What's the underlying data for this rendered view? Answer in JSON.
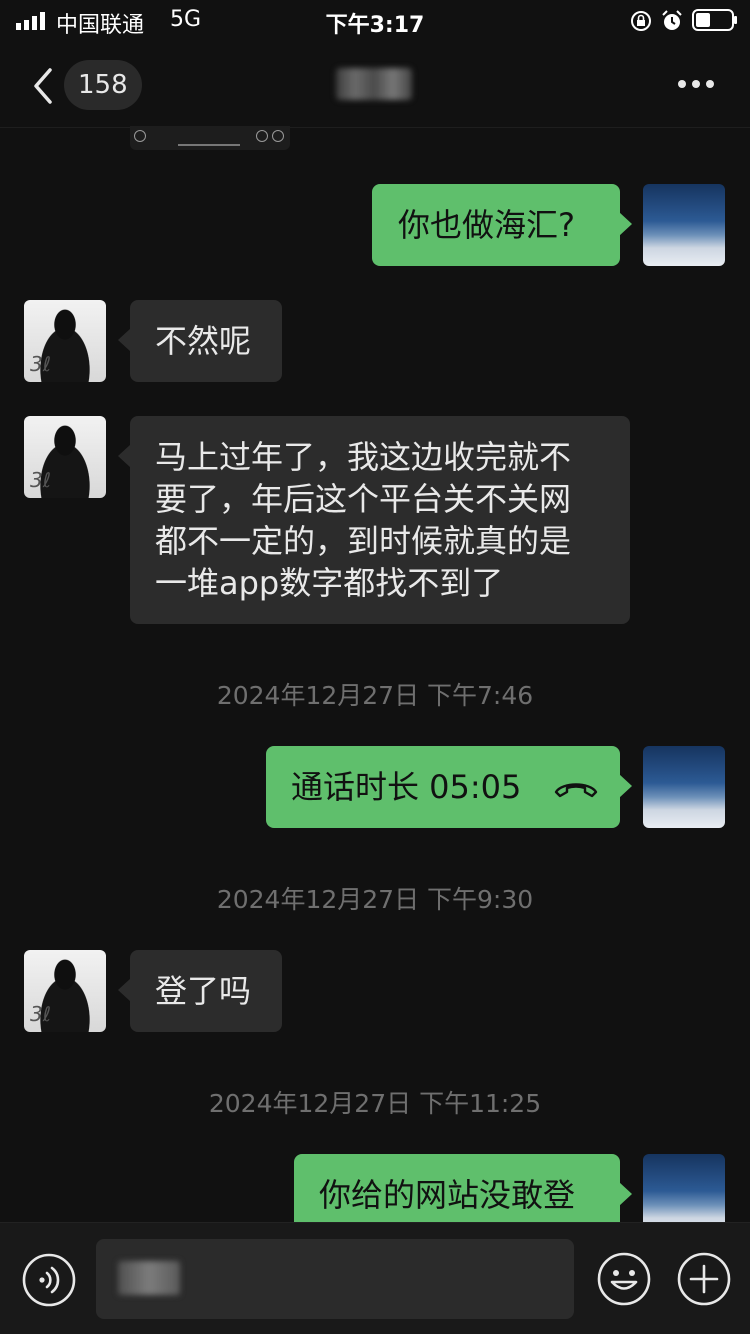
{
  "status_bar": {
    "carrier": "中国联通",
    "network": "5G",
    "time": "下午3:17",
    "icons": [
      "signal-icon",
      "rotation-lock-icon",
      "alarm-icon",
      "battery-icon"
    ]
  },
  "nav": {
    "unread_count": "158",
    "title_obscured": true,
    "icons": [
      "back-chevron-icon",
      "more-icon"
    ]
  },
  "messages": [
    {
      "sender": "me",
      "text": "你也做海汇?"
    },
    {
      "sender": "them",
      "text": "不然呢"
    },
    {
      "sender": "them",
      "lines": [
        "马上过年了，我这边收完就不",
        "要了，年后这个平台关不关网",
        "都不一定的，到时候就真的是",
        "一堆app数字都找不到了"
      ]
    },
    {
      "type": "timestamp",
      "text": "2024年12月27日 下午7:46"
    },
    {
      "sender": "me",
      "text": "通话时长 05:05",
      "icon": "phone-hangup-icon"
    },
    {
      "type": "timestamp",
      "text": "2024年12月27日 下午9:30"
    },
    {
      "sender": "them",
      "text": "登了吗"
    },
    {
      "type": "timestamp",
      "text": "2024年12月27日 下午11:25"
    },
    {
      "sender": "me",
      "text": "你给的网站没敢登"
    }
  ],
  "input_bar": {
    "draft_obscured": true,
    "icons": [
      "voice-icon",
      "emoji-icon",
      "plus-icon"
    ]
  },
  "colors": {
    "background": "#111111",
    "bubble_me": "#5fbf6c",
    "bubble_them": "#2c2c2c",
    "timestamp": "#6f6f6f"
  }
}
